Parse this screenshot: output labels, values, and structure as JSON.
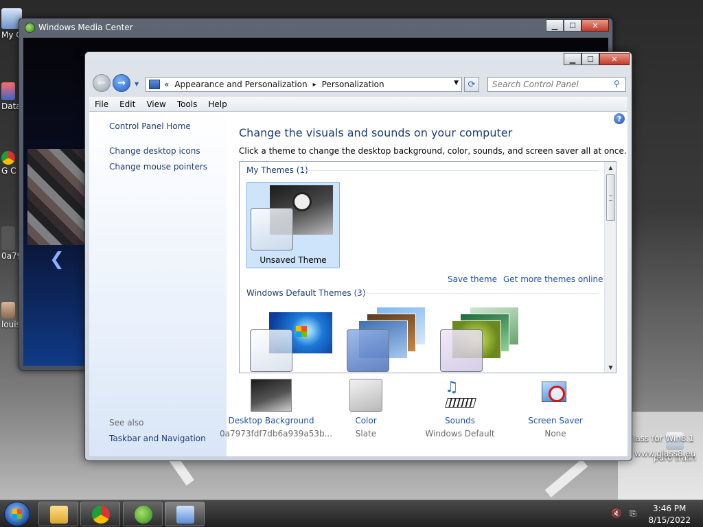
{
  "desktop": {
    "icons": [
      {
        "label": "My C"
      },
      {
        "label": "Data"
      },
      {
        "label": "G C"
      },
      {
        "label": "0a79"
      },
      {
        "label": "louis"
      },
      {
        "label": "puro trash"
      }
    ],
    "watermark": [
      "lass for Win8.1",
      "www.glass8.eu"
    ]
  },
  "wmc": {
    "title": "Windows Media Center"
  },
  "controlPanel": {
    "address": {
      "chevron": "«",
      "crumbs": [
        "Appearance and Personalization",
        "Personalization"
      ],
      "separator": "▸"
    },
    "search_placeholder": "Search Control Panel",
    "menu": [
      "File",
      "Edit",
      "View",
      "Tools",
      "Help"
    ],
    "side": {
      "links": [
        "Control Panel Home",
        "Change desktop icons",
        "Change mouse pointers"
      ],
      "see_also": "See also",
      "see_also_links": [
        "Taskbar and Navigation"
      ]
    },
    "main": {
      "title": "Change the visuals and sounds on your computer",
      "subtitle": "Click a theme to change the desktop background, color, sounds, and screen saver all at once.",
      "my_themes": "My Themes (1)",
      "unsaved_theme": "Unsaved Theme",
      "save_theme": "Save theme",
      "get_more": "Get more themes online",
      "default_themes": "Windows Default Themes (3)"
    },
    "bottom": [
      {
        "name": "Desktop Background",
        "value": "0a7973fdf7db6a939a53b..."
      },
      {
        "name": "Color",
        "value": "Slate"
      },
      {
        "name": "Sounds",
        "value": "Windows Default"
      },
      {
        "name": "Screen Saver",
        "value": "None"
      }
    ]
  },
  "taskbar": {
    "time": "3:46 PM",
    "date": "8/15/2022"
  },
  "colors": {
    "link": "#1d4fa8",
    "heading": "#1e3a78",
    "selection": "#cde4fb"
  }
}
